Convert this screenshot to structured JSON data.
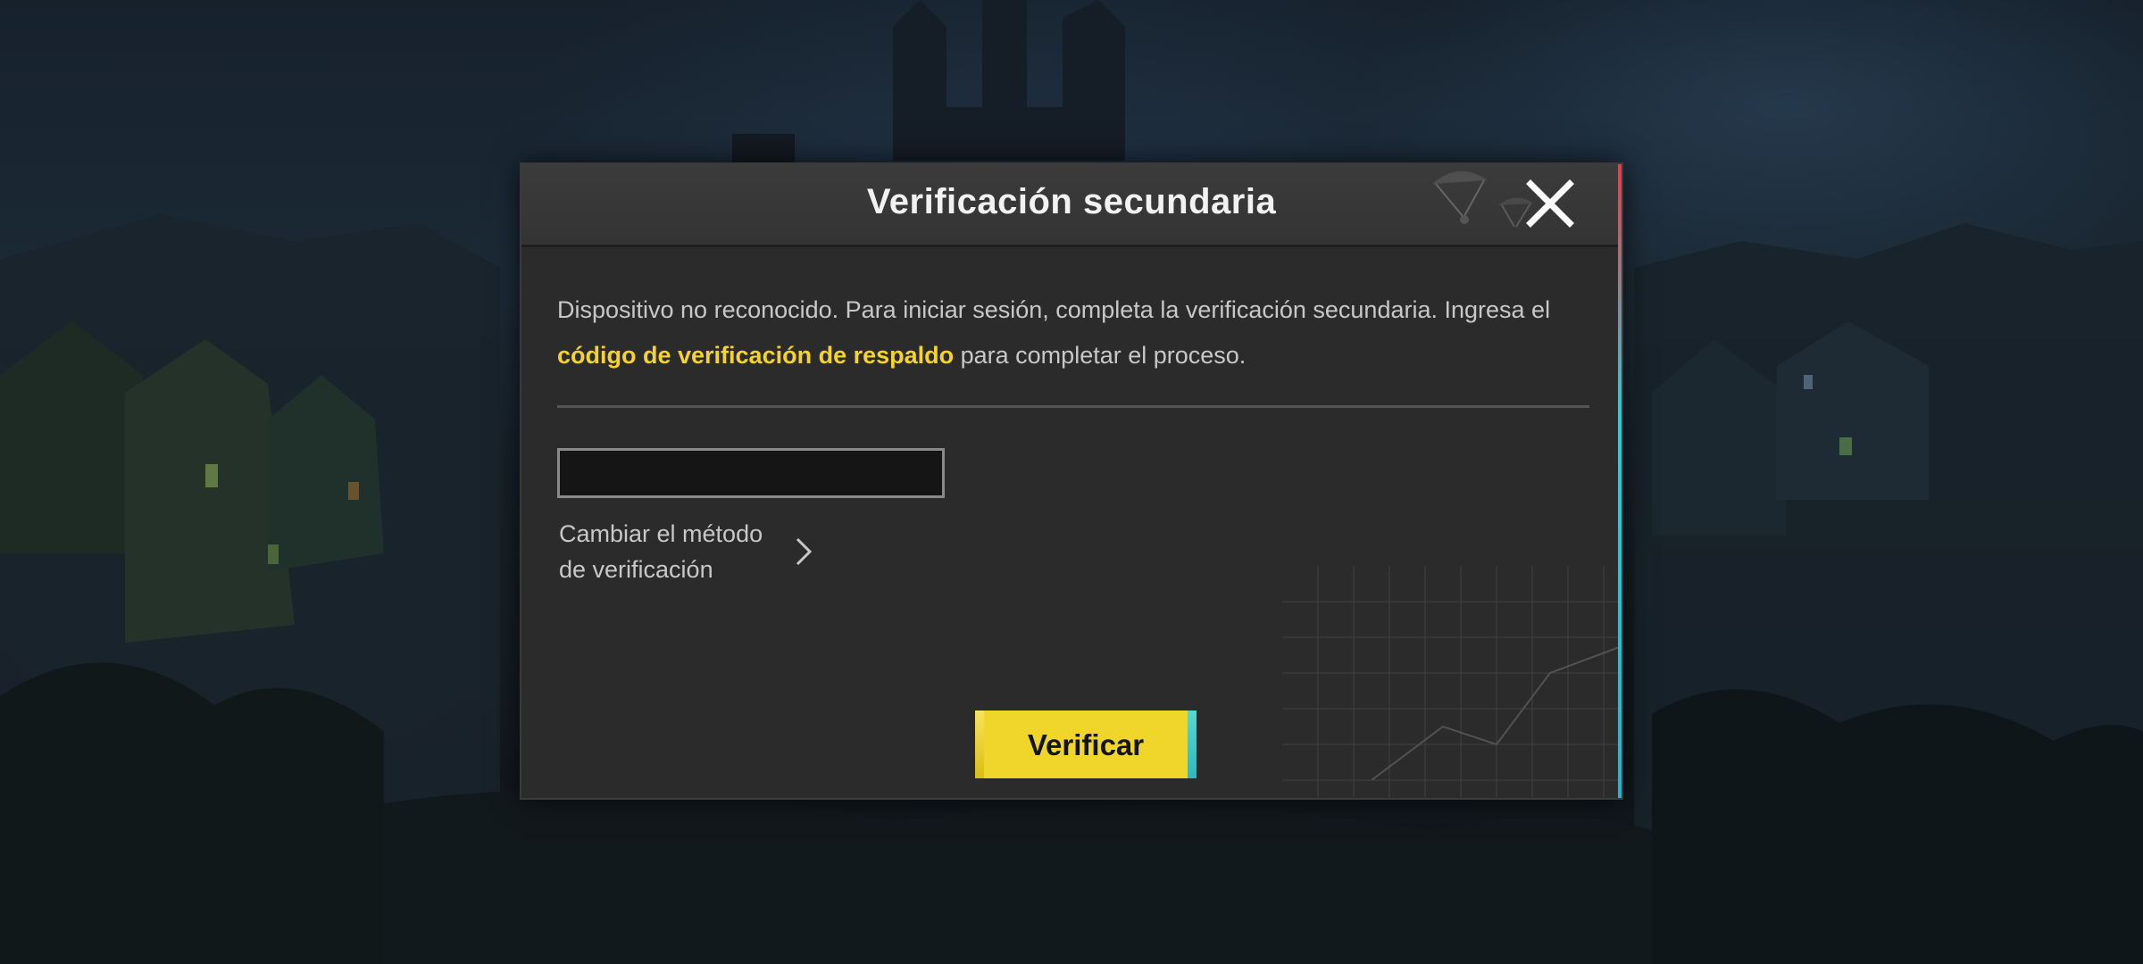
{
  "dialog": {
    "title": "Verificación secundaria",
    "message_part1": "Dispositivo no reconocido. Para iniciar sesión, completa la verificación secundaria. Ingresa el ",
    "message_highlight": "código de verificación de respaldo",
    "message_part2": " para completar el proceso.",
    "code_input": {
      "value": "",
      "placeholder": ""
    },
    "change_method_label": "Cambiar el método de verificación",
    "verify_label": "Verificar",
    "close_icon": "close-icon",
    "chevron_icon": "chevron-right-icon"
  },
  "colors": {
    "dialog_bg": "#2b2b2b",
    "title_bar_bg": "#3b3b3b",
    "highlight": "#f5d328",
    "button_bg": "#f0d52a",
    "text": "#c8c8c8"
  }
}
